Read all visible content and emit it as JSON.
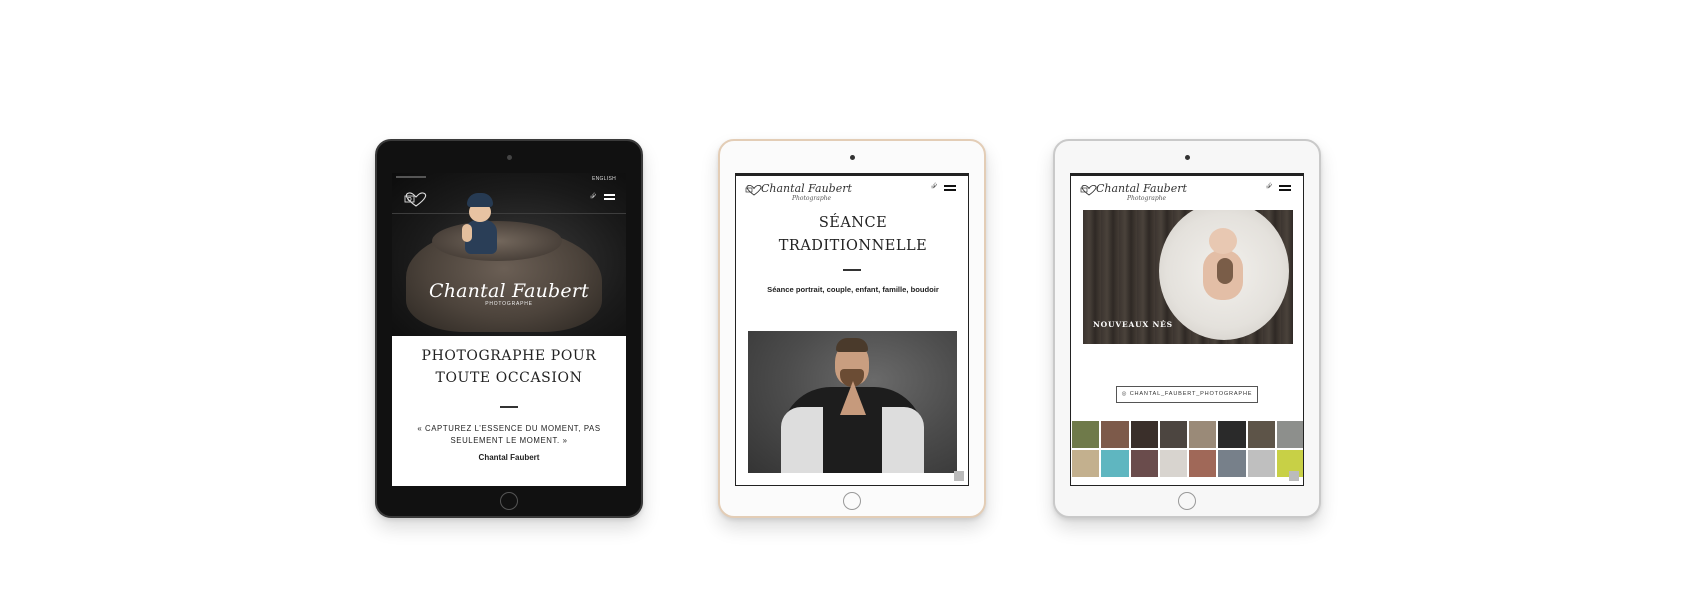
{
  "tablet1": {
    "lang": "ENGLISH",
    "hero_name": "Chantal Faubert",
    "hero_sub": "PHOTOGRAPHE",
    "title_line1": "PHOTOGRAPHE POUR",
    "title_line2": "TOUTE OCCASION",
    "quote_line1": "« CAPTUREZ L’ESSENCE DU MOMENT, PAS",
    "quote_line2": "SEULEMENT LE MOMENT. »",
    "author": "Chantal Faubert"
  },
  "tablet2": {
    "brand_name": "Chantal Faubert",
    "brand_tag": "Photographe",
    "title_line1": "SÉANCE",
    "title_line2": "TRADITIONNELLE",
    "subtitle": "Séance portrait, couple, enfant, famille, boudoir"
  },
  "tablet3": {
    "brand_name": "Chantal Faubert",
    "brand_tag": "Photographe",
    "category_label": "NOUVEAUX NÉS",
    "instagram_label": "◎ CHANTAL_FAUBERT_PHOTOGRAPHE",
    "thumb_colors": [
      "#6f7a4a",
      "#7d5a4a",
      "#3a2f2a",
      "#4c4540",
      "#9a8a78",
      "#2a2a2a",
      "#5d5448",
      "#8d8f8c",
      "#c3b08e",
      "#5fb6c0",
      "#6a4c4c",
      "#d8d4cf",
      "#a06858",
      "#77808a",
      "#bfbfbf",
      "#c8d046"
    ]
  },
  "icons": {
    "share": "share-icon",
    "menu": "hamburger-menu-icon",
    "logo": "heart-camera-logo-icon"
  }
}
